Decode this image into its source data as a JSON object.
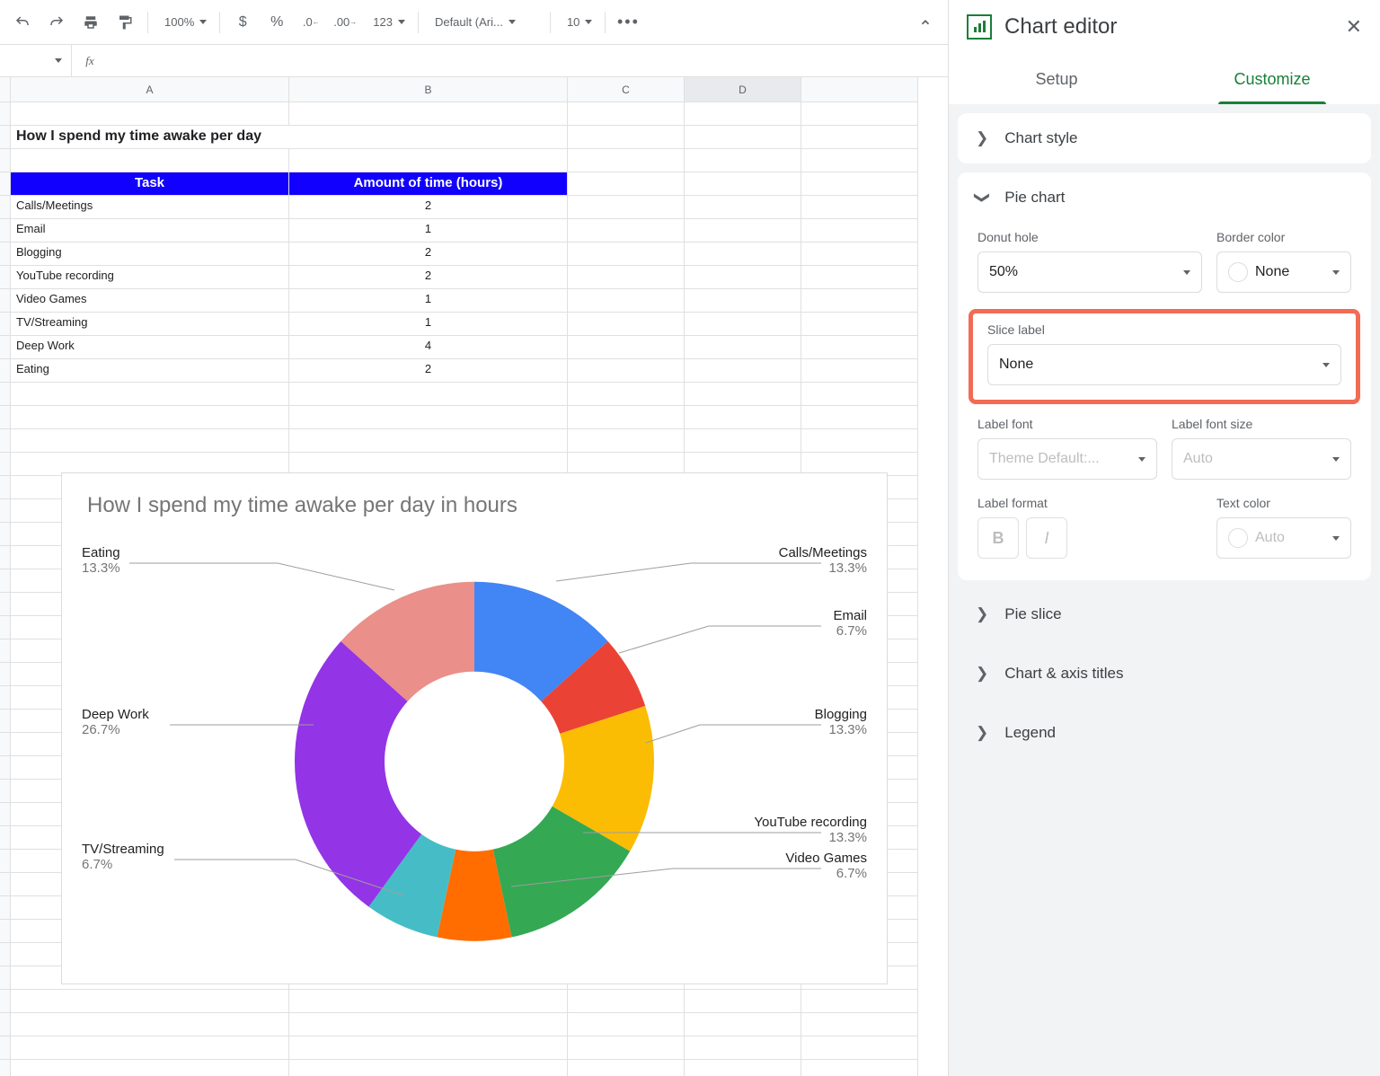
{
  "toolbar": {
    "zoom": "100%",
    "font": "Default (Ari...",
    "font_size": "10",
    "fmt_123": "123"
  },
  "sheet": {
    "columns": [
      "A",
      "B",
      "C",
      "D"
    ],
    "title": "How I spend my time awake per day",
    "headers": {
      "task": "Task",
      "amount": "Amount of time (hours)"
    },
    "rows": [
      {
        "task": "Calls/Meetings",
        "val": "2"
      },
      {
        "task": "Email",
        "val": "1"
      },
      {
        "task": "Blogging",
        "val": "2"
      },
      {
        "task": "YouTube recording",
        "val": "2"
      },
      {
        "task": "Video Games",
        "val": "1"
      },
      {
        "task": "TV/Streaming",
        "val": "1"
      },
      {
        "task": "Deep Work",
        "val": "4"
      },
      {
        "task": "Eating",
        "val": "2"
      }
    ]
  },
  "chart": {
    "title": "How I spend my time awake per day in hours",
    "labels": {
      "eating": {
        "name": "Eating",
        "pct": "13.3%"
      },
      "deep": {
        "name": "Deep Work",
        "pct": "26.7%"
      },
      "tv": {
        "name": "TV/Streaming",
        "pct": "6.7%"
      },
      "calls": {
        "name": "Calls/Meetings",
        "pct": "13.3%"
      },
      "email": {
        "name": "Email",
        "pct": "6.7%"
      },
      "blog": {
        "name": "Blogging",
        "pct": "13.3%"
      },
      "yt": {
        "name": "YouTube recording",
        "pct": "13.3%"
      },
      "vg": {
        "name": "Video Games",
        "pct": "6.7%"
      }
    }
  },
  "chart_data": {
    "type": "pie",
    "title": "How I spend my time awake per day in hours",
    "donut_hole": 0.5,
    "categories": [
      "Calls/Meetings",
      "Email",
      "Blogging",
      "YouTube recording",
      "Video Games",
      "TV/Streaming",
      "Deep Work",
      "Eating"
    ],
    "values": [
      2,
      1,
      2,
      2,
      1,
      1,
      4,
      2
    ],
    "percentages": [
      13.3,
      6.7,
      13.3,
      13.3,
      6.7,
      6.7,
      26.7,
      13.3
    ],
    "colors": [
      "#4285f4",
      "#ea4335",
      "#fbbc04",
      "#34a853",
      "#ff6d01",
      "#46bdc6",
      "#9334e6",
      "#ea8f8a"
    ]
  },
  "editor": {
    "title": "Chart editor",
    "tabs": {
      "setup": "Setup",
      "customize": "Customize"
    },
    "sections": {
      "chart_style": "Chart style",
      "pie_chart": "Pie chart",
      "pie_slice": "Pie slice",
      "axis_titles": "Chart & axis titles",
      "legend": "Legend"
    },
    "pie": {
      "donut_label": "Donut hole",
      "donut_value": "50%",
      "border_label": "Border color",
      "border_value": "None",
      "slice_label_label": "Slice label",
      "slice_label_value": "None",
      "label_font_label": "Label font",
      "label_font_value": "Theme Default:...",
      "label_size_label": "Label font size",
      "label_size_value": "Auto",
      "label_format_label": "Label format",
      "text_color_label": "Text color",
      "text_color_value": "Auto"
    }
  }
}
